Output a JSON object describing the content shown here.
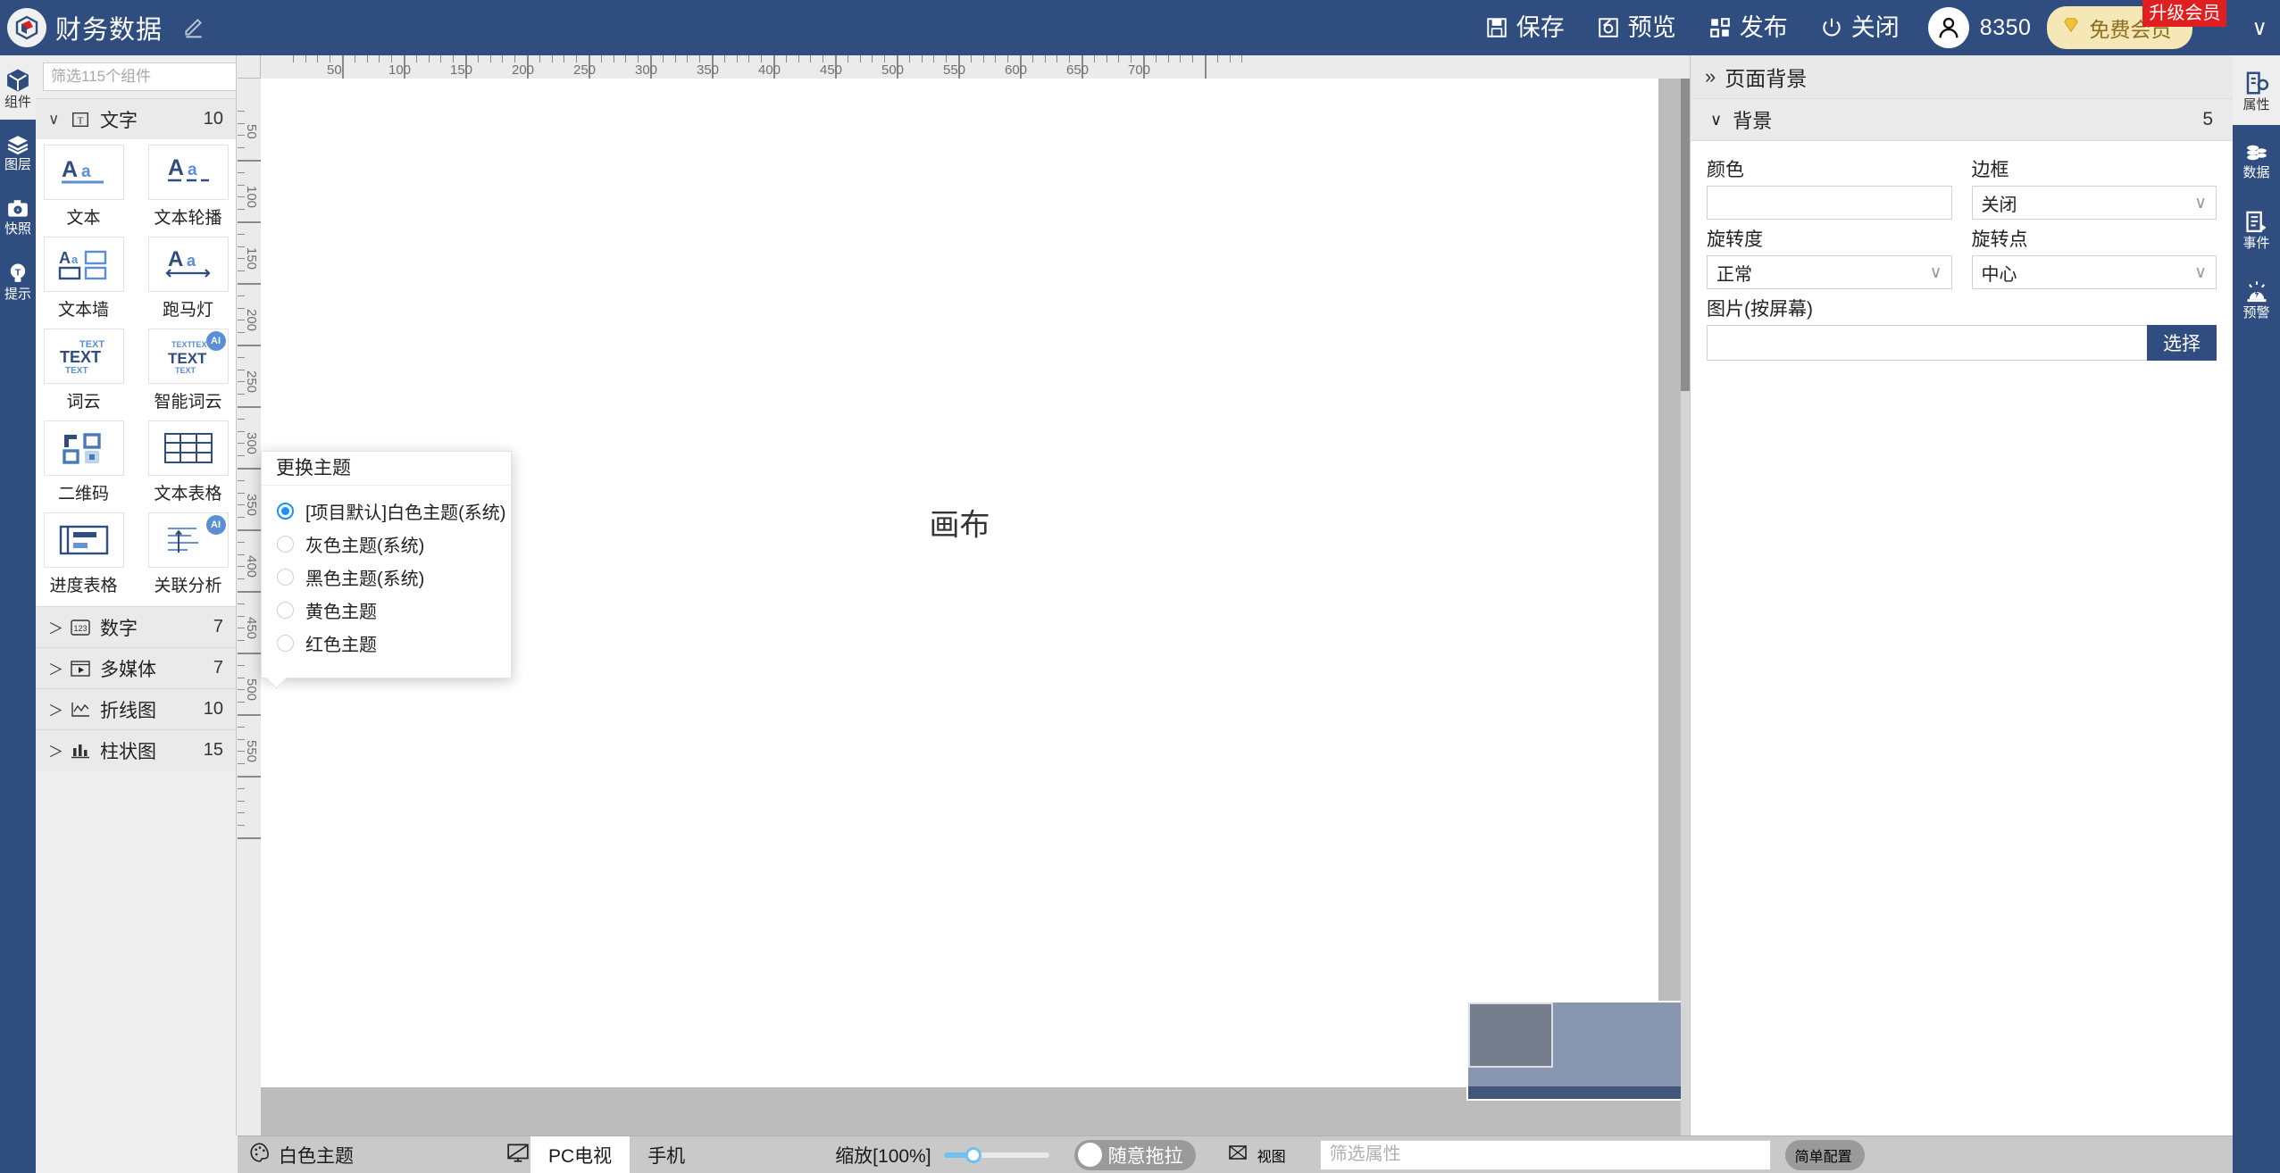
{
  "header": {
    "project_title": "财务数据",
    "edit_icon": "pencil-icon",
    "buttons": [
      {
        "label": "保存",
        "icon": "save-icon"
      },
      {
        "label": "预览",
        "icon": "preview-icon"
      },
      {
        "label": "发布",
        "icon": "publish-icon"
      },
      {
        "label": "关闭",
        "icon": "power-close-icon"
      }
    ],
    "coins": "8350",
    "vip_label": "免费会员",
    "vip_badge": "升级会员",
    "caret": "∨"
  },
  "left_rail": [
    {
      "label": "组件",
      "icon": "cube-icon",
      "active": true
    },
    {
      "label": "图层",
      "icon": "layers-icon",
      "active": false
    },
    {
      "label": "快照",
      "icon": "camera-icon",
      "active": false
    },
    {
      "label": "提示",
      "icon": "bulb-icon",
      "active": false
    }
  ],
  "component_panel": {
    "search_placeholder": "筛选115个组件",
    "search_value": "",
    "collapse_icon": "double-chevron-left-icon",
    "categories": [
      {
        "name": "文字",
        "icon": "text-t-icon",
        "count": "10",
        "expanded": true,
        "chevron": "∨",
        "items": [
          {
            "label": "文本",
            "icon": "tile-text-icon",
            "ai": false
          },
          {
            "label": "文本轮播",
            "icon": "tile-text-carousel-icon",
            "ai": false
          },
          {
            "label": "文本墙",
            "icon": "tile-text-wall-icon",
            "ai": false
          },
          {
            "label": "跑马灯",
            "icon": "tile-marquee-icon",
            "ai": false
          },
          {
            "label": "词云",
            "icon": "tile-wordcloud-icon",
            "ai": false
          },
          {
            "label": "智能词云",
            "icon": "tile-ai-wordcloud-icon",
            "ai": true
          },
          {
            "label": "二维码",
            "icon": "tile-qrcode-icon",
            "ai": false
          },
          {
            "label": "文本表格",
            "icon": "tile-text-table-icon",
            "ai": false
          },
          {
            "label": "进度表格",
            "icon": "tile-progress-table-icon",
            "ai": false
          },
          {
            "label": "关联分析",
            "icon": "tile-relation-analysis-icon",
            "ai": true
          }
        ]
      },
      {
        "name": "数字",
        "icon": "number-123-icon",
        "count": "7",
        "expanded": false,
        "chevron": "＞"
      },
      {
        "name": "多媒体",
        "icon": "media-play-icon",
        "count": "7",
        "expanded": false,
        "chevron": "＞"
      },
      {
        "name": "折线图",
        "icon": "line-chart-icon",
        "count": "10",
        "expanded": false,
        "chevron": "＞"
      },
      {
        "name": "柱状图",
        "icon": "bar-chart-icon",
        "count": "15",
        "expanded": false,
        "chevron": "＞"
      }
    ]
  },
  "canvas": {
    "label": "画布",
    "ruler_h_ticks": [
      "50",
      "100",
      "150",
      "200",
      "250",
      "300",
      "350",
      "400",
      "450",
      "500",
      "550",
      "600",
      "650",
      "700"
    ],
    "ruler_v_ticks": [
      "50",
      "100",
      "150",
      "200",
      "250",
      "300",
      "350",
      "400",
      "450",
      "500",
      "550"
    ]
  },
  "theme_popover": {
    "title": "更换主题",
    "options": [
      {
        "label": "[项目默认]白色主题(系统)",
        "selected": true
      },
      {
        "label": "灰色主题(系统)",
        "selected": false
      },
      {
        "label": "黑色主题(系统)",
        "selected": false
      },
      {
        "label": "黄色主题",
        "selected": false
      },
      {
        "label": "红色主题",
        "selected": false
      }
    ]
  },
  "property_panel": {
    "title": "页面背景",
    "title_icon": "double-chevron-right-icon",
    "section": {
      "name": "背景",
      "chevron": "∨",
      "count": "5"
    },
    "fields": {
      "color_label": "颜色",
      "color_value": "",
      "border_label": "边框",
      "border_value": "关闭",
      "rotation_label": "旋转度",
      "rotation_value": "正常",
      "rotation_point_label": "旋转点",
      "rotation_point_value": "中心",
      "image_label": "图片(按屏幕)",
      "image_value": "",
      "image_button": "选择"
    }
  },
  "right_rail": [
    {
      "label": "属性",
      "icon": "properties-icon",
      "active": true
    },
    {
      "label": "数据",
      "icon": "database-icon",
      "active": false
    },
    {
      "label": "事件",
      "icon": "event-icon",
      "active": false
    },
    {
      "label": "预警",
      "icon": "alarm-icon",
      "active": false
    }
  ],
  "bottom_bar": {
    "theme_label": "白色主题",
    "theme_icon": "palette-icon",
    "screen_icon": "monitor-icon",
    "device_tabs": [
      {
        "label": "PC电视",
        "active": true
      },
      {
        "label": "手机",
        "active": false
      }
    ],
    "zoom_label": "缩放[100%]",
    "zoom_percent": 100,
    "drag_toggle_label": "随意拖拉",
    "view_label": "视图",
    "view_icon": "view-box-icon",
    "filter_placeholder": "筛选属性",
    "filter_value": "",
    "simple_config_label": "简单配置"
  },
  "colors": {
    "brand_navy": "#2f4d7e",
    "accent_blue": "#1890ff",
    "panel_gray": "#eeeeee",
    "canvas_gray": "#bcbcbc",
    "vip_gold": "#f6e8b6",
    "badge_red": "#e02020"
  }
}
